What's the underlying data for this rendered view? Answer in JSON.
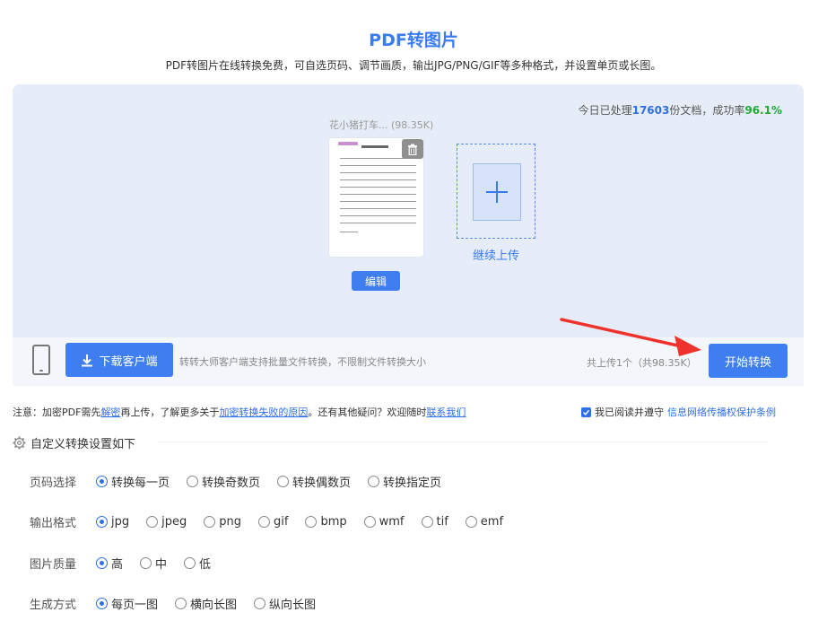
{
  "header": {
    "title": "PDF转图片",
    "subtitle": "PDF转图片在线转换免费，可自选页码、调节画质，输出JPG/PNG/GIF等多种格式，并设置单页或长图。"
  },
  "stats": {
    "prefix": "今日已处理",
    "docs": "17603",
    "middle": "份文档，成功率",
    "rate": "96.1%"
  },
  "file": {
    "name": "花小猪打车... (98.35K)",
    "edit_label": "编辑"
  },
  "upload": {
    "continue_label": "继续上传"
  },
  "action_bar": {
    "download_label": "下载客户端",
    "client_tip": "转转大师客户端支持批量文件转换，不限制文件转换大小",
    "upload_count": "共上传1个（共98.35K）",
    "start_label": "开始转换"
  },
  "notice": {
    "p1": "注意：加密PDF需先",
    "link1": "解密",
    "p2": "再上传，了解更多关于",
    "link2": "加密转换失败的原因",
    "p3": "。还有其他疑问？欢迎随时",
    "link3": "联系我们"
  },
  "agree": {
    "p1": "我已阅读并遵守",
    "link": "信息网络传播权保护条例"
  },
  "settings": {
    "title": "自定义转换设置如下",
    "rows": [
      {
        "label": "页码选择",
        "options": [
          "转换每一页",
          "转换奇数页",
          "转换偶数页",
          "转换指定页"
        ],
        "selected": 0
      },
      {
        "label": "输出格式",
        "options": [
          "jpg",
          "jpeg",
          "png",
          "gif",
          "bmp",
          "wmf",
          "tif",
          "emf"
        ],
        "selected": 0
      },
      {
        "label": "图片质量",
        "options": [
          "高",
          "中",
          "低"
        ],
        "selected": 0
      },
      {
        "label": "生成方式",
        "options": [
          "每页一图",
          "横向长图",
          "纵向长图"
        ],
        "selected": 0
      }
    ]
  },
  "colors": {
    "accent": "#3f7ef0",
    "success": "#22a83a",
    "panel": "#e6edf8",
    "arrow": "#f0322d"
  },
  "icons": [
    "trash-icon",
    "plus-icon",
    "phone-icon",
    "download-icon",
    "gear-icon",
    "checkbox-icon",
    "arrow-annotation"
  ]
}
